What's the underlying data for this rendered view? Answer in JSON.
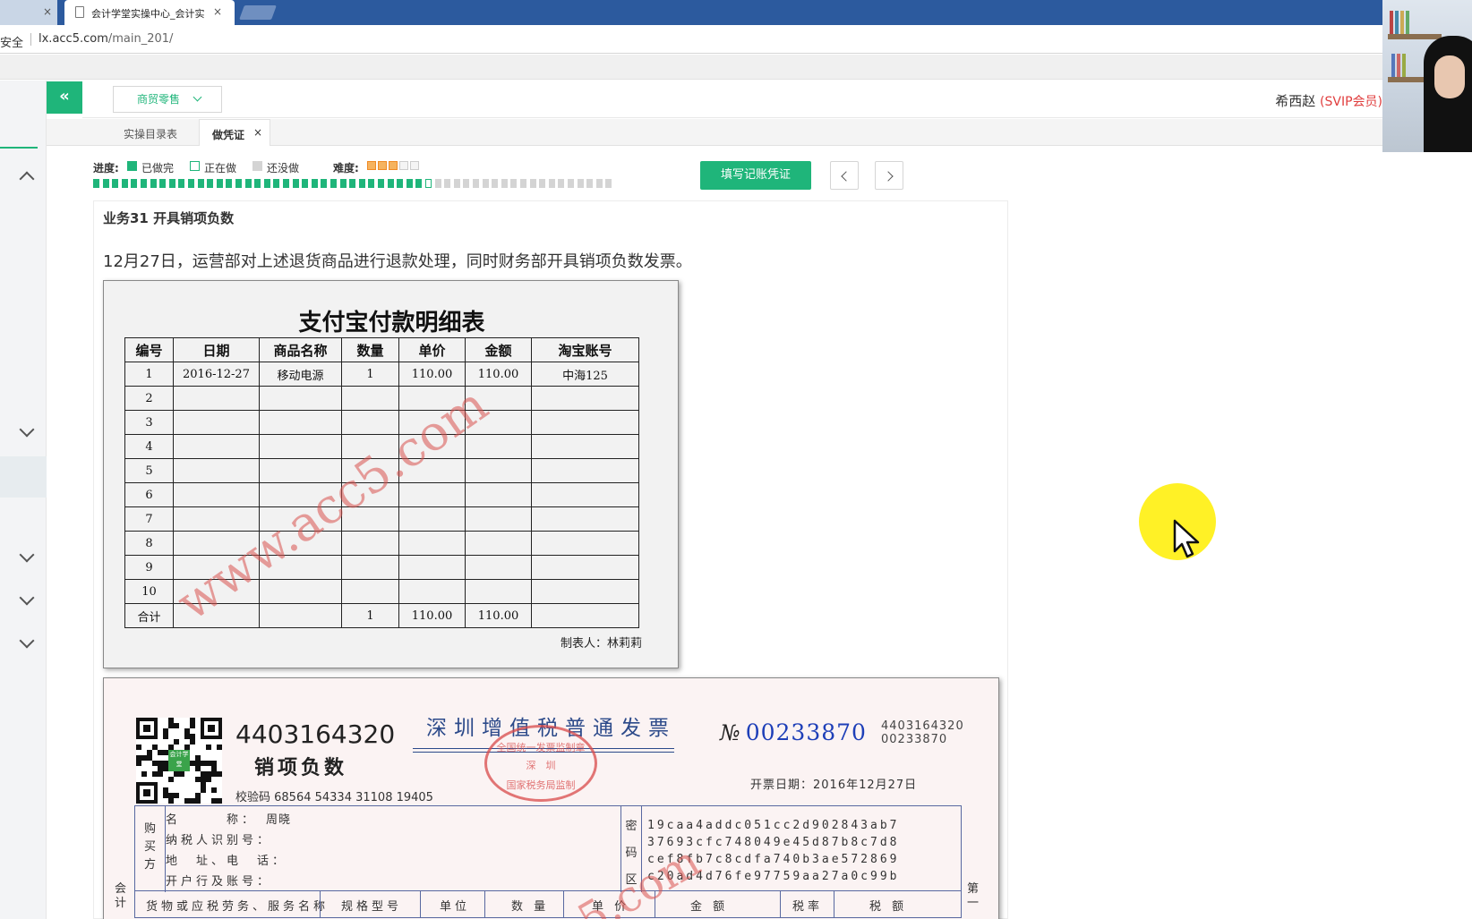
{
  "browser": {
    "inactive_tab_close": "×",
    "active_tab_title": "会计学堂实操中心_会计实",
    "active_tab_close": "×",
    "secure_label": "安全",
    "url_host": "lx.acc5.com",
    "url_path": "/main_201/"
  },
  "header": {
    "collapse_icon_glyph": "«",
    "industry_dropdown": "商贸零售",
    "user_name": "希西赵",
    "user_badge": "(SVIP会员)"
  },
  "tabs": {
    "catalog": "实操目录表",
    "current": "做凭证",
    "current_close": "×"
  },
  "progress": {
    "label": "进度:",
    "done_label": "已做完",
    "doing_label": "正在做",
    "todo_label": "还没做",
    "difficulty_label": "难度:",
    "difficulty_stars_filled": 3,
    "difficulty_stars_total": 5,
    "total_segments": 55,
    "done_segments": 35,
    "current_segment": 36,
    "fill_voucher_button": "填写记账凭证",
    "colors": {
      "done": "#1fb57a",
      "doing": "#ffffff",
      "todo": "#d4d4d4"
    }
  },
  "task": {
    "title": "业务31 开具销项负数",
    "description": "12月27日，运营部对上述退货商品进行退款处理，同时财务部开具销项负数发票。"
  },
  "alipay": {
    "title": "支付宝付款明细表",
    "headers": [
      "编号",
      "日期",
      "商品名称",
      "数量",
      "单价",
      "金额",
      "淘宝账号"
    ],
    "rows": [
      [
        "1",
        "2016-12-27",
        "移动电源",
        "1",
        "110.00",
        "110.00",
        "中海125"
      ],
      [
        "2",
        "",
        "",
        "",
        "",
        "",
        ""
      ],
      [
        "3",
        "",
        "",
        "",
        "",
        "",
        ""
      ],
      [
        "4",
        "",
        "",
        "",
        "",
        "",
        ""
      ],
      [
        "5",
        "",
        "",
        "",
        "",
        "",
        ""
      ],
      [
        "6",
        "",
        "",
        "",
        "",
        "",
        ""
      ],
      [
        "7",
        "",
        "",
        "",
        "",
        "",
        ""
      ],
      [
        "8",
        "",
        "",
        "",
        "",
        "",
        ""
      ],
      [
        "9",
        "",
        "",
        "",
        "",
        "",
        ""
      ],
      [
        "10",
        "",
        "",
        "",
        "",
        "",
        ""
      ],
      [
        "合计",
        "",
        "",
        "1",
        "110.00",
        "110.00",
        ""
      ]
    ],
    "maker": "制表人：林莉莉",
    "watermark": "www.acc5.com"
  },
  "invoice": {
    "code": "4403164320",
    "negative_label": "销项负数",
    "check_code": "校验码 68564 54334 31108 19405",
    "title": "深圳增值税普通发票",
    "seal_top": "全国统一发票监制章",
    "seal_mid": "深　圳",
    "seal_bottom": "国家税务局监制",
    "no_label": "№",
    "no_value": "00233870",
    "small_code": "4403164320",
    "small_no": "00233870",
    "date": "开票日期：2016年12月27日",
    "qr_center": "会计学堂",
    "buyer_label": "购买方",
    "buyer_name_label": "名　　　称：",
    "buyer_name": "周晓",
    "buyer_tax_label": "纳税人识别号：",
    "buyer_addr_label": "地　址、电　话：",
    "buyer_bank_label": "开户行及账号：",
    "cipher_label": "密码区",
    "cipher_lines": [
      "19caa4addc051cc2d902843ab7",
      "37693cfc748049e45d87b8c7d8",
      "cef8fb7c8cdfa740b3ae572869",
      "c20ad4d76fe97759aa27a0c99b"
    ],
    "col_goods": "货物或应税劳务、服务名称",
    "col_spec": "规格型号",
    "col_unit": "单位",
    "col_qty": "数 量",
    "col_price": "单 价",
    "col_amount": "金 额",
    "col_rate": "税率",
    "col_tax": "税 额",
    "side_left": "会计",
    "side_right": "第一",
    "watermark": "5.com"
  }
}
